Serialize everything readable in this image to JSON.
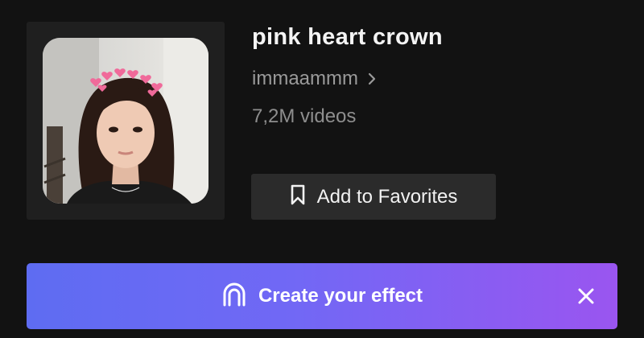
{
  "effect": {
    "title": "pink heart crown",
    "creator": "immaammm",
    "video_count": "7,2M videos"
  },
  "actions": {
    "favorite_label": "Add to Favorites",
    "create_label": "Create your effect"
  },
  "icons": {
    "creator_arrow": "chevron-right-icon",
    "favorite": "bookmark-icon",
    "create": "arch-logo-icon",
    "close": "close-icon"
  },
  "colors": {
    "background": "#121212",
    "card": "#1f1f1f",
    "button": "#2b2b2b",
    "gradient_start": "#5e6cf2",
    "gradient_end": "#9a55f0",
    "heart": "#f06a9a"
  }
}
